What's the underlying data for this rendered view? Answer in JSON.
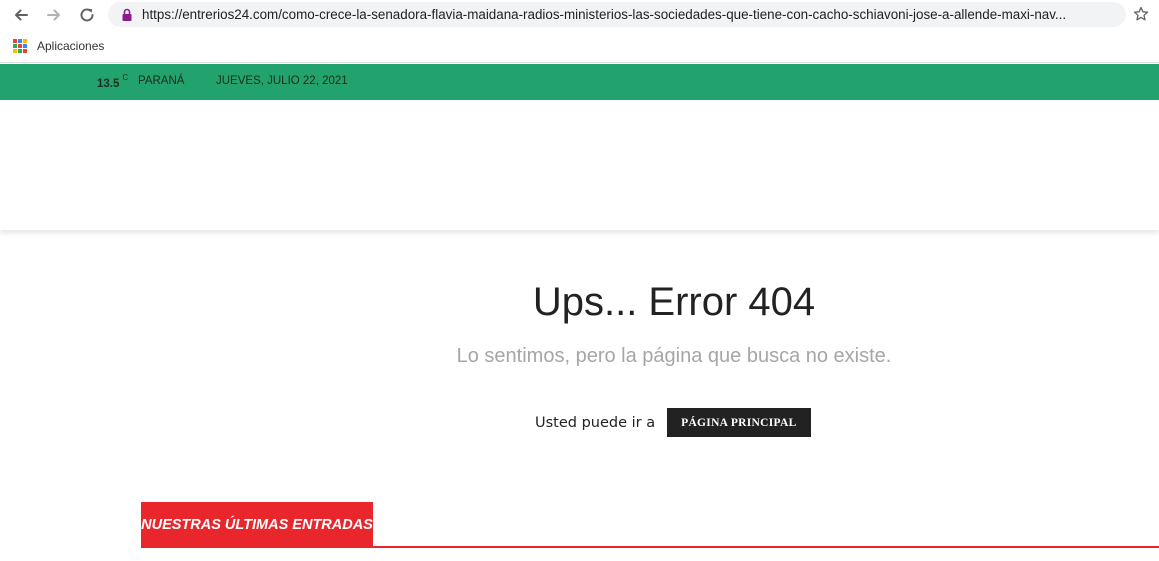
{
  "browser": {
    "url": "https://entrerios24.com/como-crece-la-senadora-flavia-maidana-radios-ministerios-las-sociedades-que-tiene-con-cacho-schiavoni-jose-a-allende-maxi-nav...",
    "bookmarks": [
      {
        "label": "Aplicaciones",
        "icon": "apps-grid-icon"
      }
    ]
  },
  "topbar": {
    "bg_color": "#22a36e",
    "weather_icon": "moon-icon",
    "temperature": "13.5",
    "temp_unit": "C",
    "city": "PARANÁ",
    "date": "JUEVES, JULIO 22, 2021"
  },
  "error": {
    "title": "Ups... Error 404",
    "subtitle": "Lo sentimos, pero la página que busca no existe.",
    "goto_text": "Usted puede ir a",
    "home_button": "PÁGINA PRINCIPAL"
  },
  "latest": {
    "title": "NUESTRAS ÚLTIMAS ENTRADAS",
    "accent_color": "#e8262b"
  }
}
